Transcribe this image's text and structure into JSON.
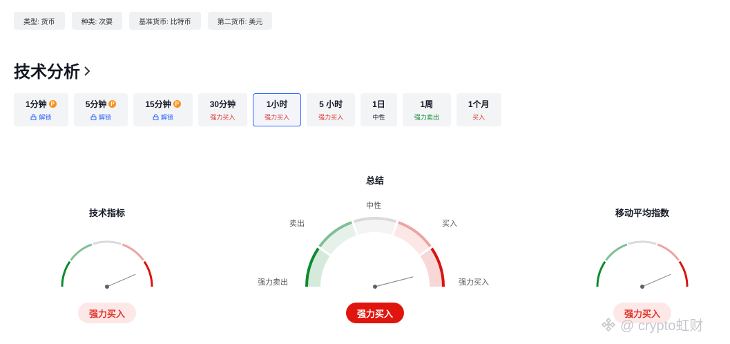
{
  "meta_chips": [
    "类型: 货币",
    "种类: 次要",
    "基准货币: 比特币",
    "第二货币: 美元"
  ],
  "section": {
    "title": "技术分析"
  },
  "timeframes": [
    {
      "label": "1分钟",
      "pro": true,
      "status": "解锁",
      "status_color": "#2962ff",
      "locked": true,
      "active": false
    },
    {
      "label": "5分钟",
      "pro": true,
      "status": "解锁",
      "status_color": "#2962ff",
      "locked": true,
      "active": false
    },
    {
      "label": "15分钟",
      "pro": true,
      "status": "解锁",
      "status_color": "#2962ff",
      "locked": true,
      "active": false
    },
    {
      "label": "30分钟",
      "pro": false,
      "status": "强力买入",
      "status_color": "#e0342b",
      "locked": false,
      "active": false
    },
    {
      "label": "1小时",
      "pro": false,
      "status": "强力买入",
      "status_color": "#e0342b",
      "locked": false,
      "active": true
    },
    {
      "label": "5 小时",
      "pro": false,
      "status": "强力买入",
      "status_color": "#e0342b",
      "locked": false,
      "active": false
    },
    {
      "label": "1日",
      "pro": false,
      "status": "中性",
      "status_color": "#131722",
      "locked": false,
      "active": false
    },
    {
      "label": "1周",
      "pro": false,
      "status": "强力卖出",
      "status_color": "#0e8a2f",
      "locked": false,
      "active": false
    },
    {
      "label": "1个月",
      "pro": false,
      "status": "买入",
      "status_color": "#e0342b",
      "locked": false,
      "active": false
    }
  ],
  "gauges": {
    "left": {
      "title": "技术指标",
      "result": "强力买入",
      "needle_level": 0.87
    },
    "center": {
      "title": "总结",
      "result": "强力买入",
      "needle_level": 0.92,
      "labels": {
        "strong_sell": "强力卖出",
        "sell": "卖出",
        "neutral": "中性",
        "buy": "买入",
        "strong_buy": "强力买入"
      }
    },
    "right": {
      "title": "移动平均指数",
      "result": "强力买入",
      "needle_level": 0.87
    }
  },
  "colors": {
    "strong_sell": "#0e8a2f",
    "sell": "#7fbf95",
    "neutral": "#d9dadd",
    "buy": "#eca5a2",
    "strong_buy": "#d8140d",
    "active_border": "#2962ff"
  },
  "watermark": "@ crypto虹财"
}
